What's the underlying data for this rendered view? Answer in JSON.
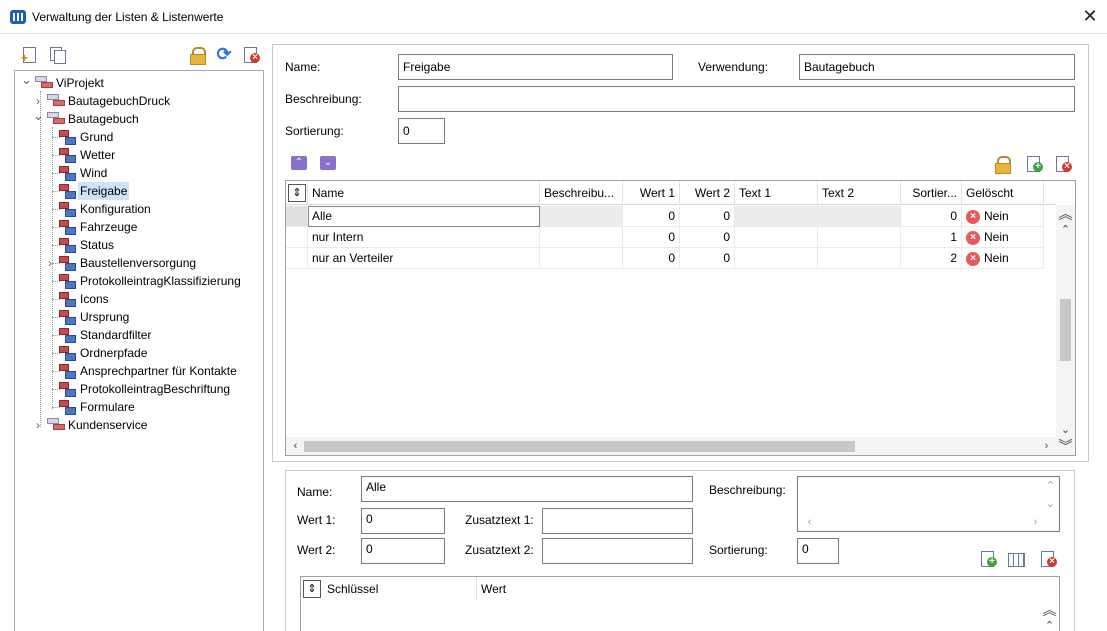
{
  "window": {
    "title": "Verwaltung der Listen & Listenwerte",
    "close_glyph": "✕"
  },
  "left_toolbar": {
    "icons": [
      "new-list-icon",
      "copy-list-icon",
      "lock-icon",
      "refresh-icon",
      "delete-list-icon"
    ]
  },
  "tree": {
    "chevron_expanded": "⌄",
    "chevron_collapsed": "›",
    "items": [
      {
        "label": "ViProjekt",
        "level": 0,
        "expander": "expanded"
      },
      {
        "label": "BautagebuchDruck",
        "level": 1,
        "expander": "collapsed"
      },
      {
        "label": "Bautagebuch",
        "level": 1,
        "expander": "expanded"
      },
      {
        "label": "Grund",
        "level": 2
      },
      {
        "label": "Wetter",
        "level": 2
      },
      {
        "label": "Wind",
        "level": 2
      },
      {
        "label": "Freigabe",
        "level": 2,
        "selected": true
      },
      {
        "label": "Konfiguration",
        "level": 2
      },
      {
        "label": "Fahrzeuge",
        "level": 2
      },
      {
        "label": "Status",
        "level": 2
      },
      {
        "label": "Baustellenversorgung",
        "level": 2,
        "expander": "collapsed"
      },
      {
        "label": "ProtokolleintragKlassifizierung",
        "level": 2
      },
      {
        "label": "Icons",
        "level": 2
      },
      {
        "label": "Ursprung",
        "level": 2
      },
      {
        "label": "Standardfilter",
        "level": 2
      },
      {
        "label": "Ordnerpfade",
        "level": 2
      },
      {
        "label": "Ansprechpartner für Kontakte",
        "level": 2
      },
      {
        "label": "ProtokolleintragBeschriftung",
        "level": 2
      },
      {
        "label": "Formulare",
        "level": 2
      },
      {
        "label": "Kundenservice",
        "level": 1,
        "expander": "collapsed"
      }
    ]
  },
  "list_form": {
    "name_label": "Name:",
    "name_value": "Freigabe",
    "verwendung_label": "Verwendung:",
    "verwendung_value": "Bautagebuch",
    "beschreibung_label": "Beschreibung:",
    "beschreibung_value": "",
    "sortierung_label": "Sortierung:",
    "sortierung_value": "0",
    "move_up_glyph": "⌃",
    "move_down_glyph": "⌄"
  },
  "values_grid": {
    "sort_glyph": "⇕",
    "columns": [
      "Name",
      "Beschreibu...",
      "Wert 1",
      "Wert 2",
      "Text 1",
      "Text 2",
      "Sortier...",
      "Gelöscht"
    ],
    "rows": [
      {
        "name": "Alle",
        "beschreibung": "",
        "wert1": "0",
        "wert2": "0",
        "text1": "",
        "text2": "",
        "sortierung": "0",
        "geloescht": "Nein",
        "selected": true
      },
      {
        "name": "nur Intern",
        "beschreibung": "",
        "wert1": "0",
        "wert2": "0",
        "text1": "",
        "text2": "",
        "sortierung": "1",
        "geloescht": "Nein"
      },
      {
        "name": "nur an Verteiler",
        "beschreibung": "",
        "wert1": "0",
        "wert2": "0",
        "text1": "",
        "text2": "",
        "sortierung": "2",
        "geloescht": "Nein"
      }
    ],
    "deleted_badge_glyph": "×",
    "scroll_left": "‹",
    "scroll_right": "›",
    "scroll_up": "⌃",
    "scroll_down": "⌄",
    "scroll_top": "︽",
    "scroll_bottom": "︾"
  },
  "value_form": {
    "name_label": "Name:",
    "name_value": "Alle",
    "beschreibung_label": "Beschreibung:",
    "beschreibung_value": "",
    "wert1_label": "Wert 1:",
    "wert1_value": "0",
    "zusatztext1_label": "Zusatztext 1:",
    "zusatztext1_value": "",
    "wert2_label": "Wert 2:",
    "wert2_value": "0",
    "zusatztext2_label": "Zusatztext 2:",
    "zusatztext2_value": "",
    "sortierung_label": "Sortierung:",
    "sortierung_value": "0",
    "textarea_scroll_up": "⌃",
    "textarea_scroll_down": "⌄",
    "textarea_scroll_left": "‹",
    "textarea_scroll_right": "›"
  },
  "key_grid": {
    "sort_glyph": "⇕",
    "columns": [
      "Schlüssel",
      "Wert"
    ],
    "scroll_top": "︽",
    "scroll_up": "⌃"
  }
}
